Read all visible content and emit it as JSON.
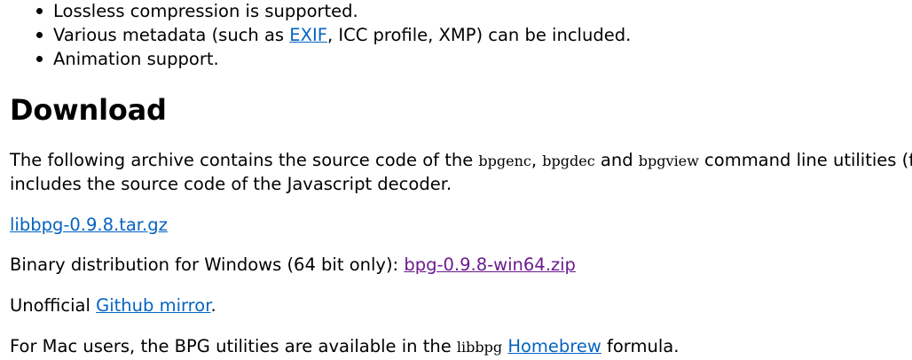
{
  "features": {
    "items": [
      {
        "text": "Lossless compression is supported."
      },
      {
        "before": "Various metadata (such as ",
        "link": "EXIF",
        "after": ", ICC profile, XMP) can be included."
      },
      {
        "text": "Animation support."
      }
    ]
  },
  "download": {
    "heading": "Download",
    "archive": {
      "t1": "The following archive contains the source code of the ",
      "c1": "bpgenc",
      "t2": ", ",
      "c2": "bpgdec",
      "t3": " and ",
      "c3": "bpgview",
      "t4": " command line utilities (fo",
      "line2": "includes the source code of the Javascript decoder."
    },
    "source_link": "libbpg-0.9.8.tar.gz",
    "binary": {
      "text": "Binary distribution for Windows (64 bit only): ",
      "link": "bpg-0.9.8-win64.zip"
    },
    "github": {
      "before": "Unofficial ",
      "link": "Github mirror",
      "after": "."
    },
    "mac": {
      "before": "For Mac users, the BPG utilities are available in the ",
      "code": "libbpg",
      "space": " ",
      "link": "Homebrew",
      "after": " formula."
    }
  }
}
